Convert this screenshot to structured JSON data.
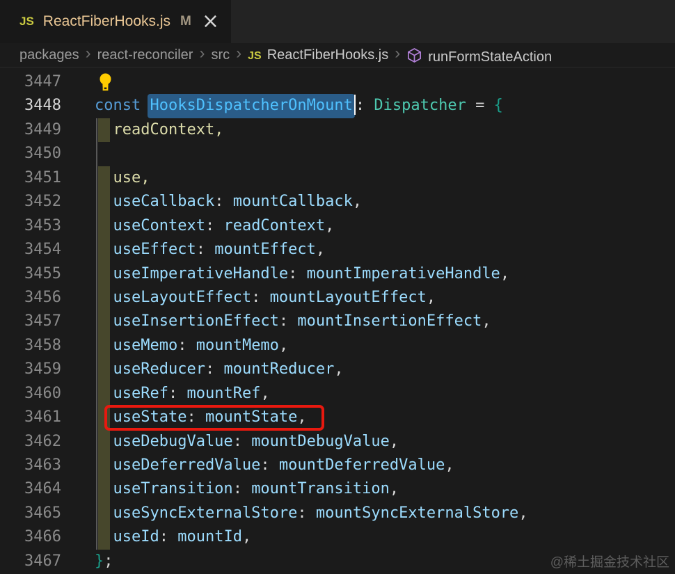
{
  "colors": {
    "bg": "#1b1b1b",
    "tabbar_bg": "#232323",
    "tab_bg": "#181818",
    "tab_title": "#eac795",
    "js_icon": "#cbcb41",
    "modified": "#a39782",
    "close": "#d4d4d4",
    "crumb": "#9b9b9b",
    "crumb_bright": "#cbcbcb",
    "separator": "#6e6e6e",
    "cube": "#b180d7",
    "border": "#2a2a2a",
    "lnum": "#8a8a8a",
    "lnum_active": "#d6d6d6",
    "guide": "#585858",
    "block": "#47472c",
    "selection": "#2a5c88",
    "cursor": "#f8f8f8",
    "kw": "#569cd6",
    "varc": "#4fc1ff",
    "typec": "#4ec9b0",
    "prop": "#9cdcfe",
    "fn": "#dcdcaa",
    "pn": "#d6d6d6",
    "brace": "#1a9e8a",
    "red_box": "#e8190f",
    "bulb": "#ffcc00",
    "watermark": "#5d5d5d"
  },
  "tab": {
    "icon_label": "JS",
    "title": "ReactFiberHooks.js",
    "modified_badge": "M",
    "close_glyph": "×"
  },
  "breadcrumb": {
    "separator": "›",
    "items": [
      {
        "label": "packages"
      },
      {
        "label": "react-reconciler"
      },
      {
        "label": "src"
      },
      {
        "label": "ReactFiberHooks.js",
        "icon": "js",
        "bright": true
      },
      {
        "label": "runFormStateAction",
        "icon": "cube",
        "bright": true
      }
    ]
  },
  "editor": {
    "lines": [
      {
        "num": "3447",
        "bulb": true,
        "tokens": []
      },
      {
        "num": "3448",
        "active": true,
        "tokens": [
          {
            "t": "const ",
            "c": "kw"
          },
          {
            "t": "HooksDispatcherOnMount",
            "c": "var",
            "sel": true
          },
          {
            "t": "",
            "c": "cursor"
          },
          {
            "t": ": ",
            "c": "pn"
          },
          {
            "t": "Dispatcher",
            "c": "type"
          },
          {
            "t": " = ",
            "c": "pn"
          },
          {
            "t": "{",
            "c": "brace"
          }
        ]
      },
      {
        "num": "3449",
        "guide": true,
        "block": true,
        "tokens": [
          {
            "t": "  readContext,",
            "c": "fn"
          }
        ]
      },
      {
        "num": "3450",
        "guide": true,
        "tokens": []
      },
      {
        "num": "3451",
        "guide": true,
        "block": true,
        "tokens": [
          {
            "t": "  use,",
            "c": "fn"
          }
        ]
      },
      {
        "num": "3452",
        "guide": true,
        "block": true,
        "tokens": [
          {
            "t": "  useCallback",
            "c": "prop"
          },
          {
            "t": ": ",
            "c": "pn"
          },
          {
            "t": "mountCallback",
            "c": "prop"
          },
          {
            "t": ",",
            "c": "pn"
          }
        ]
      },
      {
        "num": "3453",
        "guide": true,
        "block": true,
        "tokens": [
          {
            "t": "  useContext",
            "c": "prop"
          },
          {
            "t": ": ",
            "c": "pn"
          },
          {
            "t": "readContext",
            "c": "prop"
          },
          {
            "t": ",",
            "c": "pn"
          }
        ]
      },
      {
        "num": "3454",
        "guide": true,
        "block": true,
        "tokens": [
          {
            "t": "  useEffect",
            "c": "prop"
          },
          {
            "t": ": ",
            "c": "pn"
          },
          {
            "t": "mountEffect",
            "c": "prop"
          },
          {
            "t": ",",
            "c": "pn"
          }
        ]
      },
      {
        "num": "3455",
        "guide": true,
        "block": true,
        "tokens": [
          {
            "t": "  useImperativeHandle",
            "c": "prop"
          },
          {
            "t": ": ",
            "c": "pn"
          },
          {
            "t": "mountImperativeHandle",
            "c": "prop"
          },
          {
            "t": ",",
            "c": "pn"
          }
        ]
      },
      {
        "num": "3456",
        "guide": true,
        "block": true,
        "tokens": [
          {
            "t": "  useLayoutEffect",
            "c": "prop"
          },
          {
            "t": ": ",
            "c": "pn"
          },
          {
            "t": "mountLayoutEffect",
            "c": "prop"
          },
          {
            "t": ",",
            "c": "pn"
          }
        ]
      },
      {
        "num": "3457",
        "guide": true,
        "block": true,
        "tokens": [
          {
            "t": "  useInsertionEffect",
            "c": "prop"
          },
          {
            "t": ": ",
            "c": "pn"
          },
          {
            "t": "mountInsertionEffect",
            "c": "prop"
          },
          {
            "t": ",",
            "c": "pn"
          }
        ]
      },
      {
        "num": "3458",
        "guide": true,
        "block": true,
        "tokens": [
          {
            "t": "  useMemo",
            "c": "prop"
          },
          {
            "t": ": ",
            "c": "pn"
          },
          {
            "t": "mountMemo",
            "c": "prop"
          },
          {
            "t": ",",
            "c": "pn"
          }
        ]
      },
      {
        "num": "3459",
        "guide": true,
        "block": true,
        "tokens": [
          {
            "t": "  useReducer",
            "c": "prop"
          },
          {
            "t": ": ",
            "c": "pn"
          },
          {
            "t": "mountReducer",
            "c": "prop"
          },
          {
            "t": ",",
            "c": "pn"
          }
        ]
      },
      {
        "num": "3460",
        "guide": true,
        "block": true,
        "tokens": [
          {
            "t": "  useRef",
            "c": "prop"
          },
          {
            "t": ": ",
            "c": "pn"
          },
          {
            "t": "mountRef",
            "c": "prop"
          },
          {
            "t": ",",
            "c": "pn"
          }
        ]
      },
      {
        "num": "3461",
        "guide": true,
        "block": true,
        "red_box": true,
        "tokens": [
          {
            "t": "  useState",
            "c": "prop"
          },
          {
            "t": ": ",
            "c": "pn"
          },
          {
            "t": "mountState",
            "c": "prop"
          },
          {
            "t": ",",
            "c": "pn"
          }
        ]
      },
      {
        "num": "3462",
        "guide": true,
        "block": true,
        "tokens": [
          {
            "t": "  useDebugValue",
            "c": "prop"
          },
          {
            "t": ": ",
            "c": "pn"
          },
          {
            "t": "mountDebugValue",
            "c": "prop"
          },
          {
            "t": ",",
            "c": "pn"
          }
        ]
      },
      {
        "num": "3463",
        "guide": true,
        "block": true,
        "tokens": [
          {
            "t": "  useDeferredValue",
            "c": "prop"
          },
          {
            "t": ": ",
            "c": "pn"
          },
          {
            "t": "mountDeferredValue",
            "c": "prop"
          },
          {
            "t": ",",
            "c": "pn"
          }
        ]
      },
      {
        "num": "3464",
        "guide": true,
        "block": true,
        "tokens": [
          {
            "t": "  useTransition",
            "c": "prop"
          },
          {
            "t": ": ",
            "c": "pn"
          },
          {
            "t": "mountTransition",
            "c": "prop"
          },
          {
            "t": ",",
            "c": "pn"
          }
        ]
      },
      {
        "num": "3465",
        "guide": true,
        "block": true,
        "tokens": [
          {
            "t": "  useSyncExternalStore",
            "c": "prop"
          },
          {
            "t": ": ",
            "c": "pn"
          },
          {
            "t": "mountSyncExternalStore",
            "c": "prop"
          },
          {
            "t": ",",
            "c": "pn"
          }
        ]
      },
      {
        "num": "3466",
        "guide": true,
        "block": true,
        "tokens": [
          {
            "t": "  useId",
            "c": "prop"
          },
          {
            "t": ": ",
            "c": "pn"
          },
          {
            "t": "mountId",
            "c": "prop"
          },
          {
            "t": ",",
            "c": "pn"
          }
        ]
      },
      {
        "num": "3467",
        "tokens": [
          {
            "t": "}",
            "c": "brace"
          },
          {
            "t": ";",
            "c": "pn"
          }
        ]
      }
    ]
  },
  "watermark": "@稀土掘金技术社区"
}
